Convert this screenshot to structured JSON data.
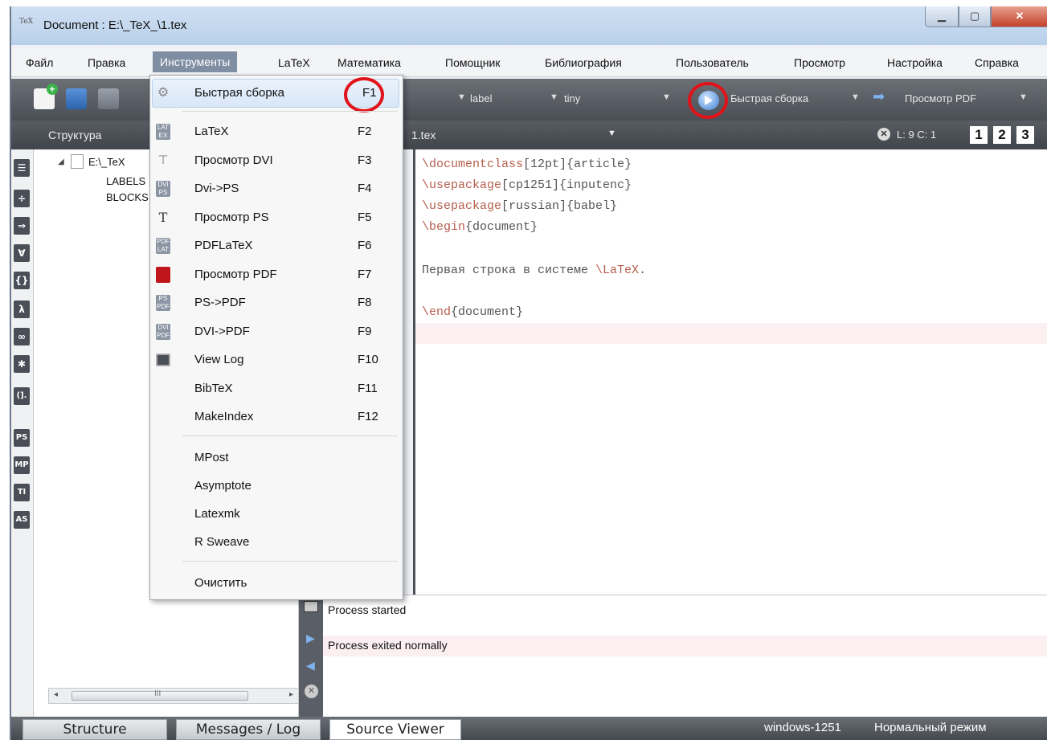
{
  "window": {
    "title": "Document : E:\\_TeX_\\1.tex",
    "app_icon_text": "TeX"
  },
  "menubar": {
    "items": [
      "Файл",
      "Правка",
      "Инструменты",
      "LaTeX",
      "Математика",
      "Помощник",
      "Библиография",
      "Пользователь",
      "Просмотр",
      "Настройка",
      "Справка"
    ]
  },
  "toolbar": {
    "combo_label": "label",
    "combo_size": "tiny",
    "quick_build": "Быстрая сборка",
    "view_pdf": "Просмотр PDF"
  },
  "panel": {
    "structure_title": "Структура",
    "file_tab": "1.tex",
    "position": "L: 9 C: 1",
    "view_buttons": [
      "1",
      "2",
      "3"
    ]
  },
  "structure_tree": {
    "root": "E:\\_TeX",
    "children": [
      "LABELS",
      "BLOCKS"
    ]
  },
  "left_icons": [
    "☰",
    "÷",
    "⇒",
    "∀",
    "{}",
    "λ",
    "∞",
    "✱",
    "(].",
    "PS",
    "MP",
    "TI",
    "AS"
  ],
  "editor": {
    "lines": [
      {
        "cmd": "\\documentclass",
        "rest": "[12pt]{article}"
      },
      {
        "cmd": "\\usepackage",
        "rest": "[cp1251]{inputenc}"
      },
      {
        "cmd": "\\usepackage",
        "rest": "[russian]{babel}"
      },
      {
        "cmd": "\\begin",
        "rest": "{document}"
      },
      {
        "cmd": "",
        "rest": ""
      },
      {
        "cmd": "",
        "rest": "Первая строка в системе ",
        "tail": "\\LaTeX",
        "end": "."
      },
      {
        "cmd": "",
        "rest": ""
      },
      {
        "cmd": "\\end",
        "rest": "{document}"
      }
    ]
  },
  "log": {
    "entries": [
      "Process started",
      "Process exited normally"
    ]
  },
  "statusbar": {
    "tabs": [
      "Structure",
      "Messages / Log",
      "Source Viewer"
    ],
    "encoding": "windows-1251",
    "mode": "Нормальный режим"
  },
  "dropdown": {
    "items": [
      {
        "label": "Быстрая сборка",
        "key": "F1",
        "icon": "gear-icon"
      },
      {
        "label": "LaTeX",
        "key": "F2",
        "icon": "latex-icon"
      },
      {
        "label": "Просмотр DVI",
        "key": "F3",
        "icon": "dvi-view-icon"
      },
      {
        "label": "Dvi->PS",
        "key": "F4",
        "icon": "dvi-ps-icon"
      },
      {
        "label": "Просмотр PS",
        "key": "F5",
        "icon": "ps-view-icon"
      },
      {
        "label": "PDFLaTeX",
        "key": "F6",
        "icon": "pdflatex-icon"
      },
      {
        "label": "Просмотр PDF",
        "key": "F7",
        "icon": "pdf-view-icon"
      },
      {
        "label": "PS->PDF",
        "key": "F8",
        "icon": "ps-pdf-icon"
      },
      {
        "label": "DVI->PDF",
        "key": "F9",
        "icon": "dvi-pdf-icon"
      },
      {
        "label": "View Log",
        "key": "F10",
        "icon": "log-icon"
      },
      {
        "label": "BibTeX",
        "key": "F11",
        "icon": ""
      },
      {
        "label": "MakeIndex",
        "key": "F12",
        "icon": ""
      },
      {
        "label": "MPost",
        "key": "",
        "icon": ""
      },
      {
        "label": "Asymptote",
        "key": "",
        "icon": ""
      },
      {
        "label": "Latexmk",
        "key": "",
        "icon": ""
      },
      {
        "label": "R Sweave",
        "key": "",
        "icon": ""
      },
      {
        "label": "Очистить",
        "key": "",
        "icon": ""
      }
    ]
  },
  "colors": {
    "highlight_circle": "#e1131a",
    "keyword": "#b65d4b",
    "menu_active": "#7f8ea3"
  }
}
